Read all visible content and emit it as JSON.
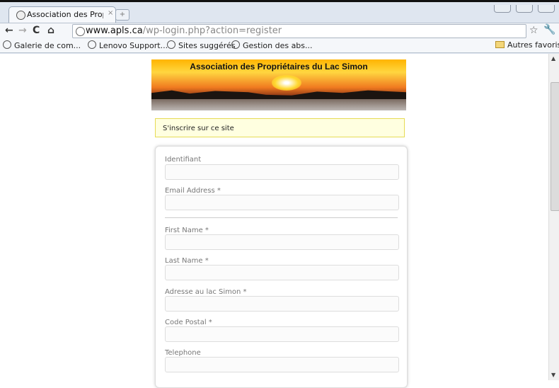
{
  "browser": {
    "tab_title": "Association des Propr",
    "url_host": "www.apls.ca",
    "url_path": "/wp-login.php?action=register",
    "bookmarks": [
      "Galerie de com...",
      "Lenovo Support...",
      "Sites suggérés",
      "Gestion des abs..."
    ],
    "other_bookmarks": "Autres favoris"
  },
  "page": {
    "banner_title": "Association des Propriétaires du Lac Simon",
    "message": "S'inscrire sur ce site",
    "fields": [
      {
        "label": "Identifiant"
      },
      {
        "label": "Email Address *"
      },
      {
        "label": "First Name *"
      },
      {
        "label": "Last Name *"
      },
      {
        "label": "Adresse au lac Simon *"
      },
      {
        "label": "Code Postal *"
      },
      {
        "label": "Telephone"
      }
    ]
  }
}
